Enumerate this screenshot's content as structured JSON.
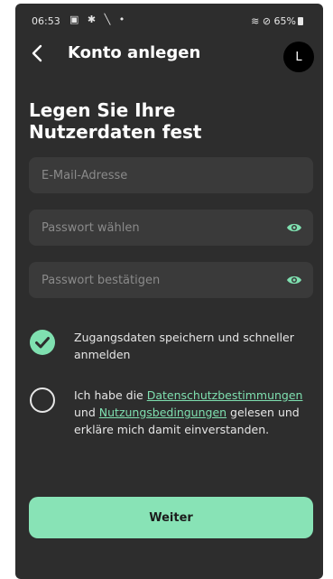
{
  "statusbar": {
    "time": "06:53",
    "left_icons": "▣ ✱ ╲ •",
    "right_text": "≋ ⊘ 65%"
  },
  "appbar": {
    "title": "Konto anlegen",
    "avatar_initial": "L"
  },
  "heading": "Legen Sie Ihre Nutzerdaten fest",
  "fields": {
    "email": {
      "placeholder": "E-Mail-Adresse",
      "value": ""
    },
    "password": {
      "placeholder": "Passwort wählen",
      "value": ""
    },
    "password_confirm": {
      "placeholder": "Passwort bestätigen",
      "value": ""
    }
  },
  "remember": {
    "checked": true,
    "label": "Zugangsdaten speichern und schneller anmelden"
  },
  "consent": {
    "checked": false,
    "text_before": "Ich habe die ",
    "link1": "Datenschutzbestim­mungen",
    "text_middle": " und ",
    "link2": "Nutzungsbedingungen",
    "text_after": " gelesen und erkläre mich damit einverstanden."
  },
  "submit_label": "Weiter",
  "colors": {
    "background": "#2d2d2d",
    "field": "#3a3a3a",
    "accent": "#7fe0b0",
    "button": "#88e3b6"
  }
}
